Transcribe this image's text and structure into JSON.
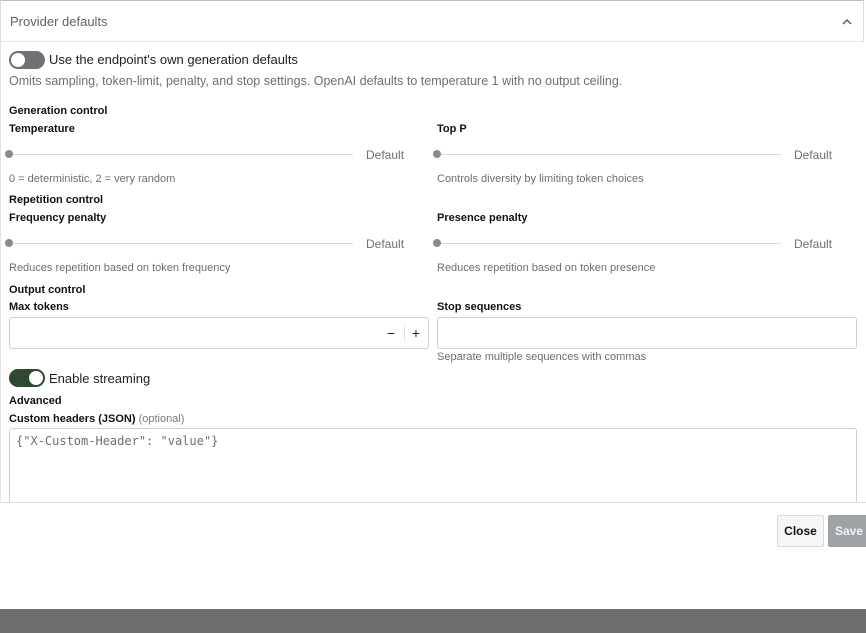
{
  "section": {
    "title": "Provider defaults"
  },
  "endpoint_defaults": {
    "label": "Use the endpoint's own generation defaults",
    "help": "Omits sampling, token-limit, penalty, and stop settings. OpenAI defaults to temperature 1 with no output ceiling.",
    "enabled": false
  },
  "generation": {
    "title": "Generation control",
    "temperature": {
      "label": "Temperature",
      "value": "Default",
      "help": "0 = deterministic, 2 = very random"
    },
    "top_p": {
      "label": "Top P",
      "value": "Default",
      "help": "Controls diversity by limiting token choices"
    }
  },
  "repetition": {
    "title": "Repetition control",
    "frequency": {
      "label": "Frequency penalty",
      "value": "Default",
      "help": "Reduces repetition based on token frequency"
    },
    "presence": {
      "label": "Presence penalty",
      "value": "Default",
      "help": "Reduces repetition based on token presence"
    }
  },
  "output": {
    "title": "Output control",
    "max_tokens": {
      "label": "Max tokens",
      "value": "",
      "minus": "−",
      "plus": "+"
    },
    "stop": {
      "label": "Stop sequences",
      "value": "",
      "help": "Separate multiple sequences with commas"
    }
  },
  "streaming": {
    "label": "Enable streaming",
    "enabled": true
  },
  "advanced": {
    "title": "Advanced",
    "headers_label": "Custom headers (JSON)",
    "headers_optional": "(optional)",
    "headers_placeholder": "{\"X-Custom-Header\": \"value\"}"
  },
  "footer": {
    "close": "Close",
    "save": "Save"
  },
  "icons": {
    "collapse": "chevron-up-icon"
  },
  "colors": {
    "toggle_on": "#2d4a2e",
    "toggle_off": "#6e7175",
    "save_disabled": "#9ea3a8"
  }
}
